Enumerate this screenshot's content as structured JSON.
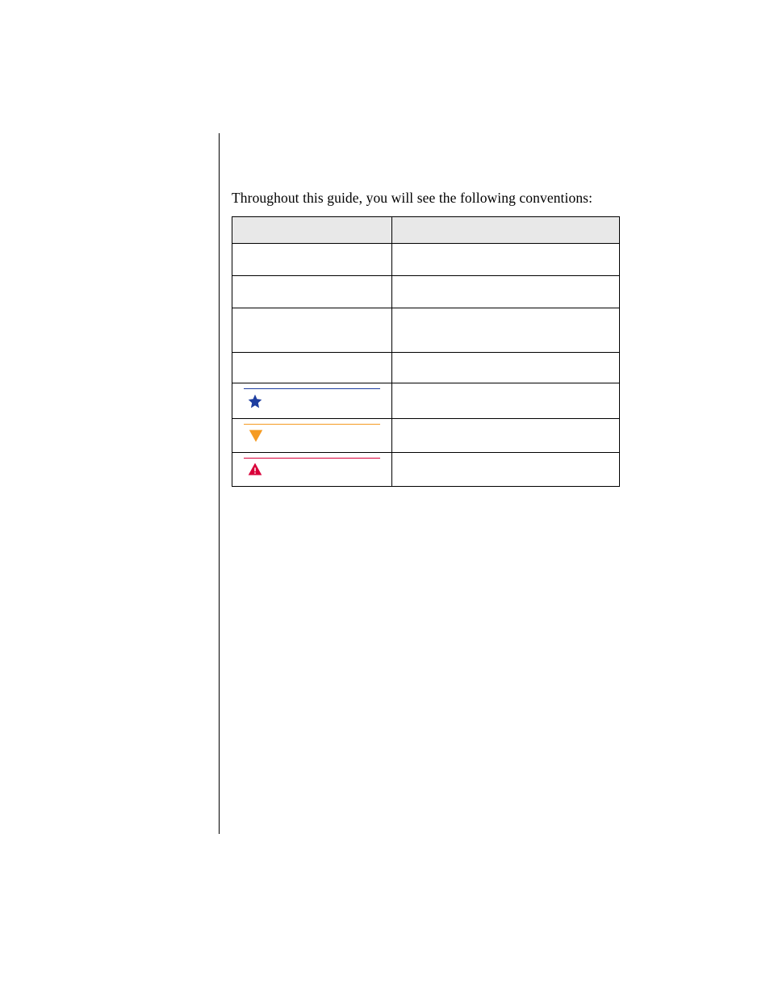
{
  "intro_text": "Throughout this guide, you will see the following conventions:",
  "table": {
    "header": {
      "col1": "",
      "col2": ""
    },
    "rows": [
      {
        "col1": "",
        "col2": "",
        "type": "std"
      },
      {
        "col1": "",
        "col2": "",
        "type": "std"
      },
      {
        "col1": "",
        "col2": "",
        "type": "tall"
      },
      {
        "col1": "",
        "col2": "",
        "type": "short"
      },
      {
        "col1": "",
        "col2": "",
        "type": "note"
      },
      {
        "col1": "",
        "col2": "",
        "type": "caution"
      },
      {
        "col1": "",
        "col2": "",
        "type": "warning"
      }
    ]
  },
  "colors": {
    "note": "#1e3ea0",
    "caution": "#f59b23",
    "warning": "#d9003a",
    "header_bg": "#e8e8e8"
  }
}
